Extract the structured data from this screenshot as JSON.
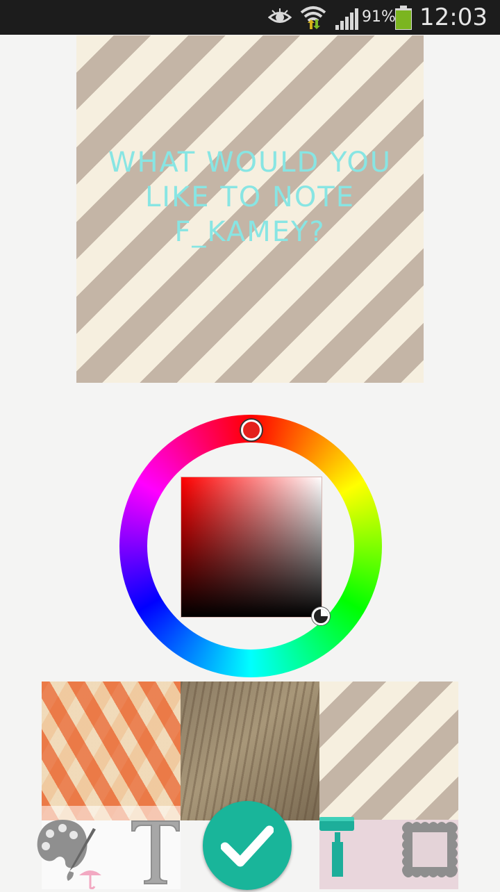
{
  "status_bar": {
    "battery_percent": "91%",
    "time": "12:03",
    "icons": [
      "eye-icon",
      "wifi-icon",
      "signal-icon",
      "battery-icon"
    ]
  },
  "note": {
    "text": "What would you like to note f_kamey?",
    "text_color": "#88e5e3",
    "background": "striped-beige"
  },
  "color_picker": {
    "selected_hue": "#ff0000"
  },
  "backgrounds": [
    "geometric-pattern",
    "bark-texture",
    "beige-stripes"
  ],
  "toolbar": {
    "tools": [
      "palette-icon",
      "text-tool-icon",
      "confirm-check-icon",
      "paint-roller-icon",
      "stamp-frame-icon"
    ]
  }
}
